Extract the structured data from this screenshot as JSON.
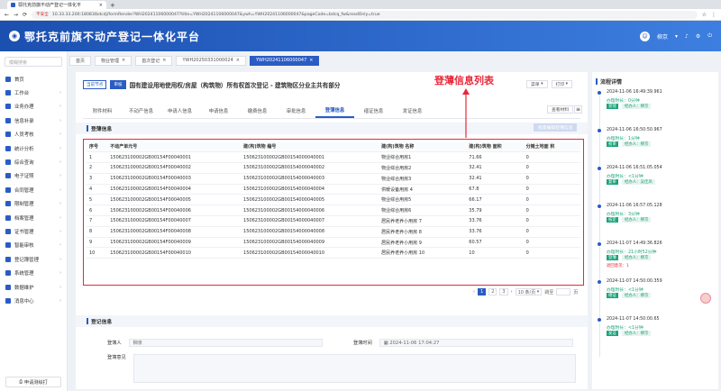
{
  "browser": {
    "tab_title": "鄂托克前旗不动产登记一体化平",
    "url_security": "不安全",
    "url": "10.33.33.200:18083/bdcdj/formRender?WH20241106000047?title=YWH20241106000047&ywh=YWH20241106000047&pageCode=bdcq_fw&readOnly=true"
  },
  "app": {
    "title": "鄂托克前旗不动产登记一体化平台",
    "user": "柳京"
  },
  "sidebar": {
    "search_placeholder": "模糊搜索",
    "items": [
      "首页",
      "工作台",
      "业务办理",
      "信息补录",
      "人员考核",
      "统计分析",
      "综合查询",
      "电子证照",
      "合同管理",
      "限制管理",
      "档案管理",
      "证书管理",
      "智能审核",
      "登记簿管理",
      "系统管理",
      "数据维护",
      "消息中心"
    ],
    "bottom": "申请测绘打"
  },
  "page_tabs": [
    {
      "label": "首页",
      "closable": false
    },
    {
      "label": "物业管理",
      "closable": true
    },
    {
      "label": "首次登记",
      "closable": true
    },
    {
      "label": "YWH20250331000024",
      "closable": true
    },
    {
      "label": "YWH20241106000047",
      "closable": true,
      "active": true
    }
  ],
  "doc": {
    "tag1": "当前节点",
    "tag2": "审核",
    "title": "国有建设用地使用权/房屋（构筑物）所有权首次登记 - 建筑物区分业主共有部分",
    "btn_menu": "菜单",
    "btn_print": "打印"
  },
  "form_tabs": [
    "附件材料",
    "不动产信息",
    "申请人信息",
    "申请信息",
    "缴费信息",
    "审批信息",
    "登薄信息",
    "缮证信息",
    "发证信息"
  ],
  "active_tab": "登薄信息",
  "btn_view_material": "查看材料",
  "btn_batch": "批量编辑登簿信息",
  "section1": "登薄信息",
  "table": {
    "headers": [
      "序号",
      "不动产单元号",
      "建(构)筑物 编号",
      "建(构)筑物 名称",
      "建(构)筑物 面积",
      "分摊土地面 积"
    ],
    "rows": [
      [
        "1",
        "150623100002GB00154F00040001",
        "150623100002GB00154000040001",
        "物业综合用房1",
        "71.66",
        "0"
      ],
      [
        "2",
        "150623100002GB00154F00040002",
        "150623100002GB00154000040002",
        "物业综合用房2",
        "32.41",
        "0"
      ],
      [
        "3",
        "150623100002GB00154F00040003",
        "150623100002GB00154000040003",
        "物业综合用房3",
        "32.41",
        "0"
      ],
      [
        "4",
        "150623100002GB00154F00040004",
        "150623100002GB00154000040004",
        "供暖设备用房 4",
        "67.8",
        "0"
      ],
      [
        "5",
        "150623100002GB00154F00040005",
        "150623100002GB00154000040005",
        "物业综合用房5",
        "66.17",
        "0"
      ],
      [
        "6",
        "150623100002GB00154F00040006",
        "150623100002GB00154000040006",
        "物业综合用房6",
        "35.79",
        "0"
      ],
      [
        "7",
        "150623100002GB00154F00040007",
        "150623100002GB00154000040007",
        "居民养老养小用房 7",
        "33.76",
        "0"
      ],
      [
        "8",
        "150623100002GB00154F00040008",
        "150623100002GB00154000040008",
        "居民养老养小用房 8",
        "33.76",
        "0"
      ],
      [
        "9",
        "150623100002GB00154F00040009",
        "150623100002GB00154000040009",
        "居民养老养小用房 9",
        "60.57",
        "0"
      ],
      [
        "10",
        "150623100002GB00154F00040010",
        "150623100002GB00154000040010",
        "居民养老养小用房 10",
        "10",
        "0"
      ]
    ]
  },
  "annotation": "登薄信息列表",
  "pager": {
    "pages": [
      "1",
      "2",
      "3"
    ],
    "current": "1",
    "size": "10 条/页",
    "goto": "跳至",
    "unit": "页"
  },
  "section2": "登记信息",
  "form": {
    "reg_person_label": "登簿人",
    "reg_person": "柳京",
    "reg_time_label": "登簿时间",
    "reg_time": "2024-11-06 17:04:27",
    "opinion_label": "登簿意见"
  },
  "right_panel": {
    "title": "流程详情",
    "items": [
      {
        "time": "2024-11-06 16:49:39.961",
        "status": "办理时长：0分钟",
        "tag": "受理",
        "person": "经办人：柳京"
      },
      {
        "time": "2024-11-06 16:50:50.967",
        "status": "办理时长：1分钟",
        "tag": "初审",
        "person": "经办人：柳京"
      },
      {
        "time": "2024-11-06 16:51:05.054",
        "status": "办理时长：<1分钟",
        "tag": "复审",
        "person": "经办人：吴佳凤"
      },
      {
        "time": "2024-11-06 16:57:05.128",
        "status": "办理时长：3分钟",
        "tag": "核定",
        "person": "经办人：柳京"
      },
      {
        "time": "2024-11-07 14:49:36.826",
        "status": "办理时长：21小时52分钟",
        "tag": "登簿",
        "person": "经办人：柳京",
        "extra": "退回意见：1"
      },
      {
        "time": "2024-11-07 14:50:00.359",
        "status": "办理时长：<1分钟",
        "tag": "缮证",
        "person": "经办人：柳京"
      },
      {
        "time": "2024-11-07 14:50:00.65",
        "status": "办理时长：<1分钟",
        "tag": "发证",
        "person": "经办人：柳京"
      }
    ]
  }
}
